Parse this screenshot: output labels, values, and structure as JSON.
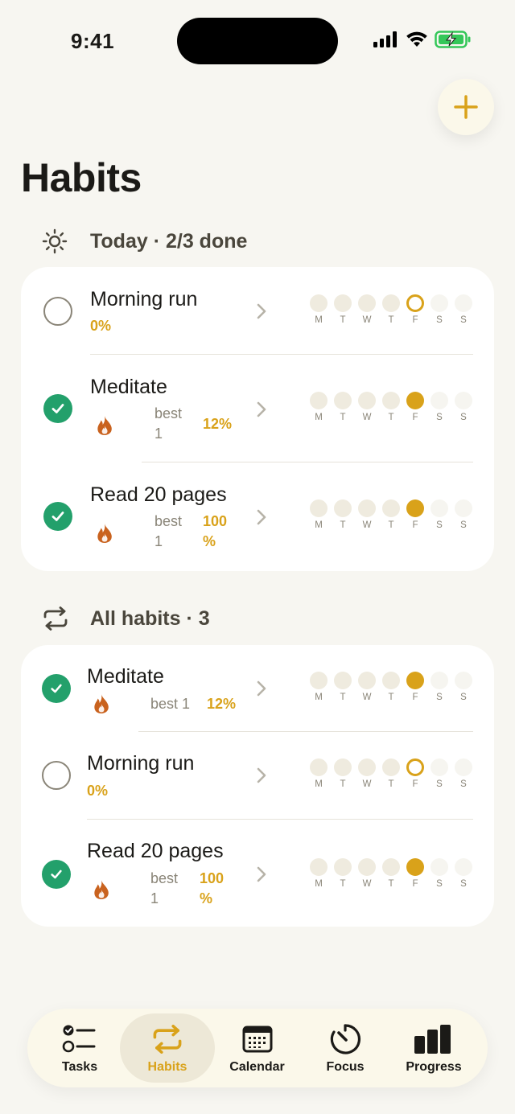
{
  "status_bar": {
    "time": "9:41"
  },
  "colors": {
    "accent": "#d9a21a",
    "check_green": "#23a06b",
    "flame": "#c9621e",
    "background": "#f7f6f1"
  },
  "page": {
    "title": "Habits"
  },
  "today_section": {
    "title": "Today · 2/3 done",
    "icon": "sun-icon",
    "habits": [
      {
        "name": "Morning run",
        "done": false,
        "percent": "0%",
        "best_label": "",
        "best_value": "",
        "week": [
          "past",
          "past",
          "past",
          "past",
          "today-open",
          "future",
          "future"
        ]
      },
      {
        "name": "Meditate",
        "done": true,
        "percent": "12%",
        "best_label": "best",
        "best_value": "1",
        "week": [
          "past",
          "past",
          "past",
          "past",
          "today-done",
          "future",
          "future"
        ]
      },
      {
        "name": "Read 20 pages",
        "done": true,
        "percent_a": "100",
        "percent_b": "%",
        "best_label": "best",
        "best_value": "1",
        "week": [
          "past",
          "past",
          "past",
          "past",
          "today-done",
          "future",
          "future"
        ]
      }
    ]
  },
  "all_section": {
    "title": "All habits · 3",
    "icon": "repeat-icon",
    "habits": [
      {
        "name": "Meditate",
        "done": true,
        "best": "best 1",
        "percent": "12%"
      },
      {
        "name": "Morning run",
        "done": false,
        "percent": "0%"
      },
      {
        "name": "Read 20 pages",
        "done": true,
        "best_label": "best",
        "best_value": "1",
        "percent_a": "100",
        "percent_b": "%"
      }
    ]
  },
  "week_days": [
    "M",
    "T",
    "W",
    "T",
    "F",
    "S",
    "S"
  ],
  "tabbar": {
    "tabs": [
      {
        "label": "Tasks",
        "icon": "tasks-icon",
        "active": false
      },
      {
        "label": "Habits",
        "icon": "repeat-icon",
        "active": true
      },
      {
        "label": "Calendar",
        "icon": "calendar-icon",
        "active": false
      },
      {
        "label": "Focus",
        "icon": "timer-icon",
        "active": false
      },
      {
        "label": "Progress",
        "icon": "bar-chart-icon",
        "active": false
      }
    ]
  }
}
